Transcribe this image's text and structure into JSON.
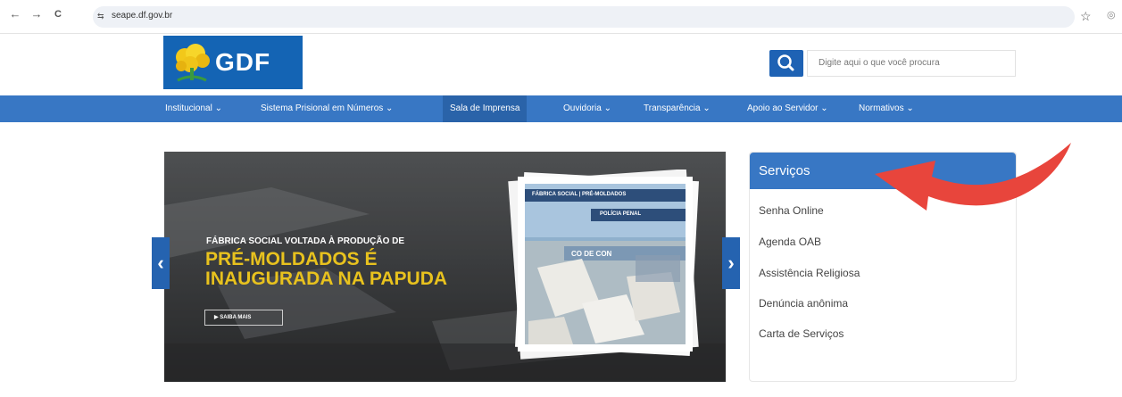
{
  "browser": {
    "url": "seape.df.gov.br",
    "back_icon": "←",
    "forward_icon": "→",
    "reload_icon": "C",
    "site_info_icon": "⇆",
    "star_icon": "☆"
  },
  "header": {
    "logo_text": "GDF",
    "search_placeholder": "Digite aqui o que você procura"
  },
  "nav": {
    "items": [
      {
        "label": "Institucional ⌄"
      },
      {
        "label": "Sistema Prisional em Números ⌄"
      },
      {
        "label": "Sala de Imprensa"
      },
      {
        "label": "Ouvidoria ⌄"
      },
      {
        "label": "Transparência ⌄"
      },
      {
        "label": "Apoio ao Servidor ⌄"
      },
      {
        "label": "Normativos ⌄"
      }
    ],
    "active_index": 2
  },
  "hero": {
    "kicker": "FÁBRICA SOCIAL VOLTADA À PRODUÇÃO DE",
    "headline_line1": "PRÉ-MOLDADOS É",
    "headline_line2": "INAUGURADA NA PAPUDA",
    "cta": "▶   SAIBA MAIS",
    "photo_sign1": "FÁBRICA SOCIAL  |  PRÉ-MOLDADOS",
    "photo_sign2": "POLÍCIA PENAL",
    "photo_sign3": "CO DE CON",
    "prev_icon": "‹",
    "next_icon": "›"
  },
  "services": {
    "title": "Serviços",
    "items": [
      "Senha Online",
      "Agenda OAB",
      "Assistência Religiosa",
      "Denúncia anônima",
      "Carta de Serviços"
    ]
  },
  "colors": {
    "brand_blue": "#3877c4",
    "logo_blue": "#1464b4",
    "headline_yellow": "#e8c21e",
    "annotation_red": "#e8453c"
  }
}
